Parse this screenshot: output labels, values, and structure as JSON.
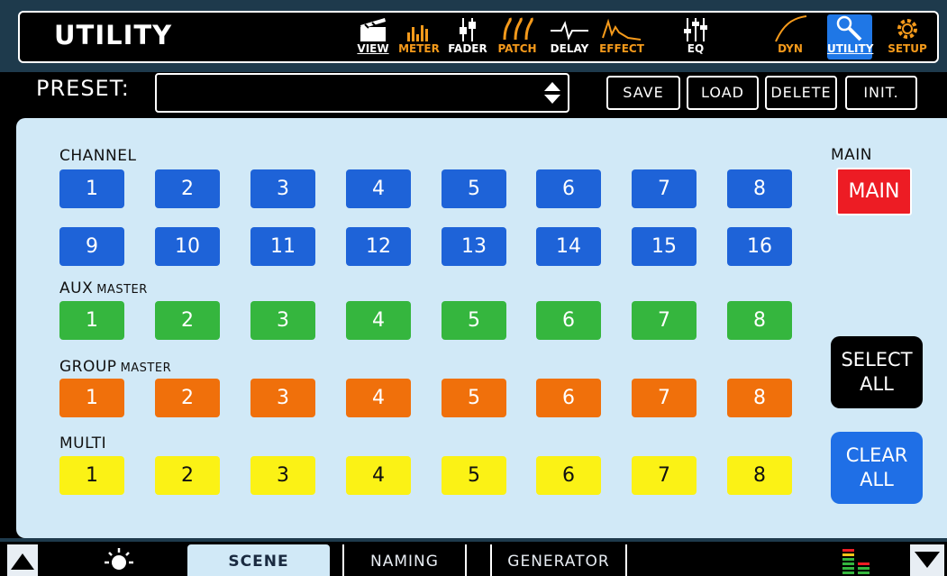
{
  "header": {
    "title": "UTILITY",
    "nav": [
      {
        "label": "VIEW",
        "icon": "clapperboard-icon",
        "color": "#ffffff"
      },
      {
        "label": "METER",
        "icon": "meter-bars-icon",
        "color": "#f59a1b"
      },
      {
        "label": "FADER",
        "icon": "fader-icon",
        "color": "#ffffff"
      },
      {
        "label": "PATCH",
        "icon": "patch-cable-icon",
        "color": "#f59a1b"
      },
      {
        "label": "DELAY",
        "icon": "delay-wave-icon",
        "color": "#ffffff"
      },
      {
        "label": "EFFECT",
        "icon": "effect-wave-icon",
        "color": "#f59a1b"
      },
      {
        "label": "EQ",
        "icon": "eq-sliders-icon",
        "color": "#ffffff"
      },
      {
        "label": "DYN",
        "icon": "dynamics-curve-icon",
        "color": "#f59a1b"
      },
      {
        "label": "UTILITY",
        "icon": "wrench-icon",
        "color": "#ffffff",
        "active": true
      },
      {
        "label": "SETUP",
        "icon": "gear-icon",
        "color": "#f59a1b"
      }
    ]
  },
  "preset": {
    "label": "PRESET:",
    "value": "",
    "buttons": {
      "save": "SAVE",
      "load": "LOAD",
      "delete": "DELETE",
      "init": "INIT."
    }
  },
  "sections": {
    "channel": {
      "label": "CHANNEL",
      "row1": [
        "1",
        "2",
        "3",
        "4",
        "5",
        "6",
        "7",
        "8"
      ],
      "row2": [
        "9",
        "10",
        "11",
        "12",
        "13",
        "14",
        "15",
        "16"
      ],
      "color": "#1e63d8"
    },
    "aux": {
      "label": "AUX",
      "sublabel": "MASTER",
      "items": [
        "1",
        "2",
        "3",
        "4",
        "5",
        "6",
        "7",
        "8"
      ],
      "color": "#35b63e"
    },
    "group": {
      "label": "GROUP",
      "sublabel": "MASTER",
      "items": [
        "1",
        "2",
        "3",
        "4",
        "5",
        "6",
        "7",
        "8"
      ],
      "color": "#f0700b"
    },
    "multi": {
      "label": "MULTI",
      "items": [
        "1",
        "2",
        "3",
        "4",
        "5",
        "6",
        "7",
        "8"
      ],
      "color": "#fbf215"
    },
    "main": {
      "label": "MAIN",
      "button": "MAIN",
      "color": "#ed1c24"
    }
  },
  "actions": {
    "select_all": [
      "SELECT",
      "ALL"
    ],
    "clear_all": [
      "CLEAR",
      "ALL"
    ]
  },
  "tabs": {
    "scene": "SCENE",
    "naming": "NAMING",
    "generator": "GENERATOR",
    "active": "SCENE"
  },
  "footer_icons": [
    "scroll-up-arrow-icon",
    "brightness-icon",
    "level-meter-icon",
    "scroll-down-arrow-icon"
  ]
}
